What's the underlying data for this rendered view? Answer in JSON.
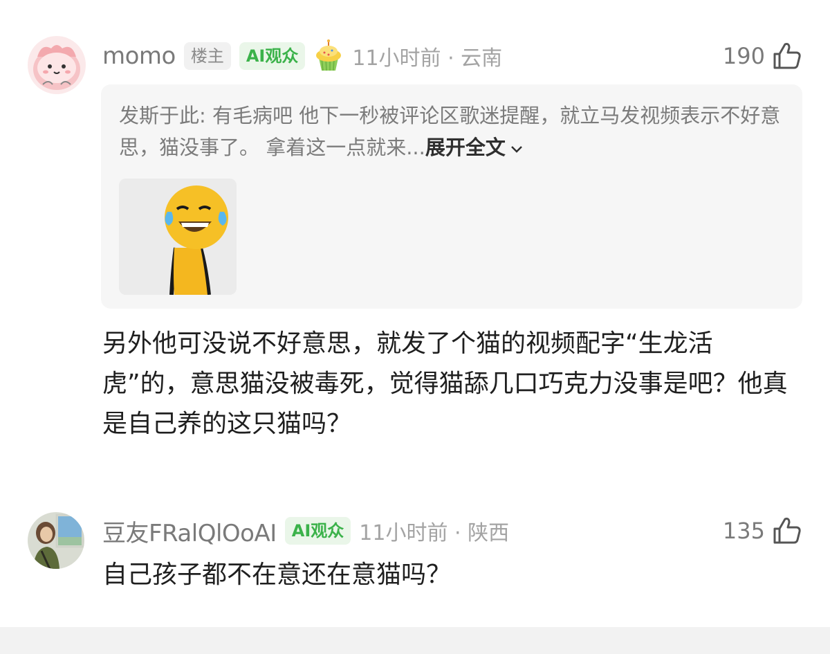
{
  "comments": [
    {
      "username": "momo",
      "owner_badge": "楼主",
      "ai_badge": "AI观众",
      "meta": "11小时前 · 云南",
      "likes": "190",
      "avatar_icon": "pink-cat-avatar",
      "decoration_icon": "cupcake-icon",
      "quote": {
        "author": "发斯于此:",
        "text": " 有毛病吧 他下一秒被评论区歌迷提醒，就立马发视频表示不好意思，猫没事了。  拿着这一点就来...",
        "expand_label": "展开全文",
        "sticker_icon": "laughing-crying-emoji-sticker"
      },
      "text": "另外他可没说不好意思，就发了个猫的视频配字“生龙活虎”的，意思猫没被毒死，觉得猫舔几口巧克力没事是吧？他真是自己养的这只猫吗？"
    },
    {
      "username": "豆友FRalQlOoAI",
      "ai_badge": "AI观众",
      "meta": "11小时前 · 陕西",
      "likes": "135",
      "avatar_icon": "train-window-photo-avatar",
      "text": "自己孩子都不在意还在意猫吗？"
    }
  ],
  "colors": {
    "ai_badge_text": "#3bb24a",
    "ai_badge_bg": "#eaf6e9",
    "muted_text": "#a3a3a3",
    "body_text": "#1f1f1f"
  }
}
